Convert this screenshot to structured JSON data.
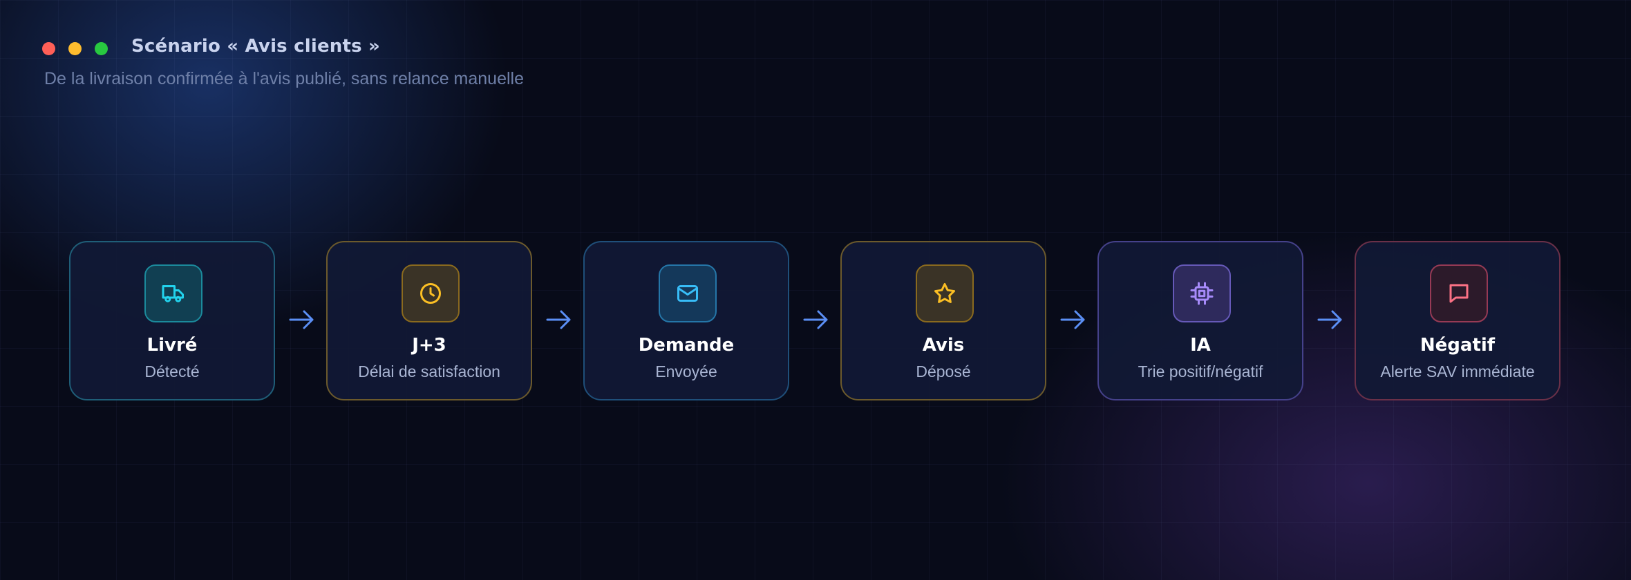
{
  "header": {
    "title": "Scénario « Avis clients »",
    "subtitle": "De la livraison confirmée à l'avis publié, sans relance manuelle"
  },
  "steps": [
    {
      "label": "Livré",
      "sub": "Détecté",
      "icon": "truck-icon",
      "accent": "#22d3ee"
    },
    {
      "label": "J+3",
      "sub": "Délai de satisfaction",
      "icon": "clock-icon",
      "accent": "#fbbf24"
    },
    {
      "label": "Demande",
      "sub": "Envoyée",
      "icon": "mail-icon",
      "accent": "#38bdf8"
    },
    {
      "label": "Avis",
      "sub": "Déposé",
      "icon": "star-icon",
      "accent": "#fbbf24"
    },
    {
      "label": "IA",
      "sub": "Trie positif/négatif",
      "icon": "cpu-icon",
      "accent": "#a78bfa"
    },
    {
      "label": "Négatif",
      "sub": "Alerte SAV immédiate",
      "icon": "message-icon",
      "accent": "#fb7185"
    }
  ],
  "colors": {
    "background": "#080b19",
    "arrow": "#5b8ff5",
    "window_red": "#ff5f57",
    "window_yellow": "#febc2e",
    "window_green": "#28c840"
  }
}
